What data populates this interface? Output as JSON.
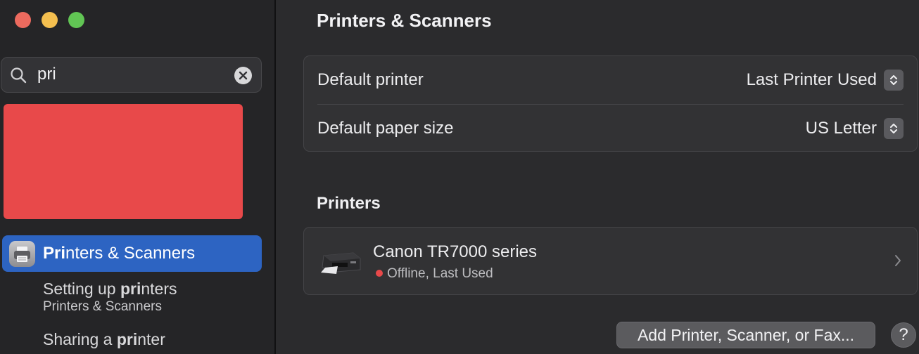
{
  "sidebar": {
    "search": {
      "value": "pri"
    },
    "selected": {
      "label_pre": "Pri",
      "label_post": "nters & Scanners"
    },
    "results": [
      {
        "title_pre": "Setting up ",
        "title_match": "pri",
        "title_post": "nters",
        "subtitle": "Printers & Scanners"
      },
      {
        "title_pre": "Sharing a ",
        "title_match": "pri",
        "title_post": "nter",
        "subtitle": ""
      }
    ]
  },
  "main": {
    "title": "Printers & Scanners",
    "settings": {
      "default_printer_label": "Default printer",
      "default_printer_value": "Last Printer Used",
      "paper_size_label": "Default paper size",
      "paper_size_value": "US Letter"
    },
    "printers_section": "Printers",
    "printers": [
      {
        "name": "Canon TR7000 series",
        "status": "Offline, Last Used"
      }
    ],
    "add_button": "Add Printer, Scanner, or Fax...",
    "help_button": "?"
  },
  "colors": {
    "accent": "#2d64c2",
    "status_offline": "#e8494a"
  }
}
